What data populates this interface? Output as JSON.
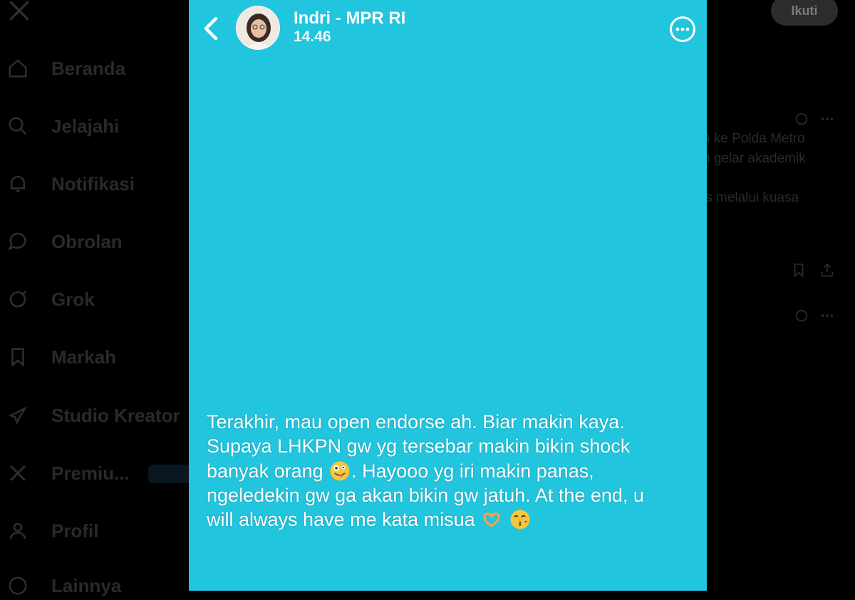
{
  "nav": {
    "items": [
      {
        "label": "Beranda",
        "icon": "home-icon"
      },
      {
        "label": "Jelajahi",
        "icon": "search-icon"
      },
      {
        "label": "Notifikasi",
        "icon": "bell-icon"
      },
      {
        "label": "Obrolan",
        "icon": "chat-icon"
      },
      {
        "label": "Grok",
        "icon": "grok-icon"
      },
      {
        "label": "Markah",
        "icon": "bookmark-icon"
      },
      {
        "label": "Studio Kreator",
        "icon": "rocket-icon"
      },
      {
        "label": "Premiu...",
        "icon": "x-premium-icon"
      },
      {
        "label": "Profil",
        "icon": "person-icon"
      },
      {
        "label": "Lainnya",
        "icon": "more-circle-icon"
      }
    ]
  },
  "right_column": {
    "follow_label": "Ikuti",
    "snippets": [
      "n ke Polda Metro",
      "n gelar akademik",
      "is melalui kuasa"
    ]
  },
  "story": {
    "username": "Indri - MPR RI",
    "time": "14.46",
    "background_color": "#22c5de",
    "caption_lines": [
      "Terakhir, mau open endorse ah. Biar makin kaya.",
      "Supaya LHKPN gw yg tersebar makin bikin shock",
      "banyak orang",
      ". Hayooo yg iri makin panas,",
      "ngeledekin gw ga akan bikin gw jatuh. At the end, u",
      "will always have me kata misua"
    ]
  }
}
